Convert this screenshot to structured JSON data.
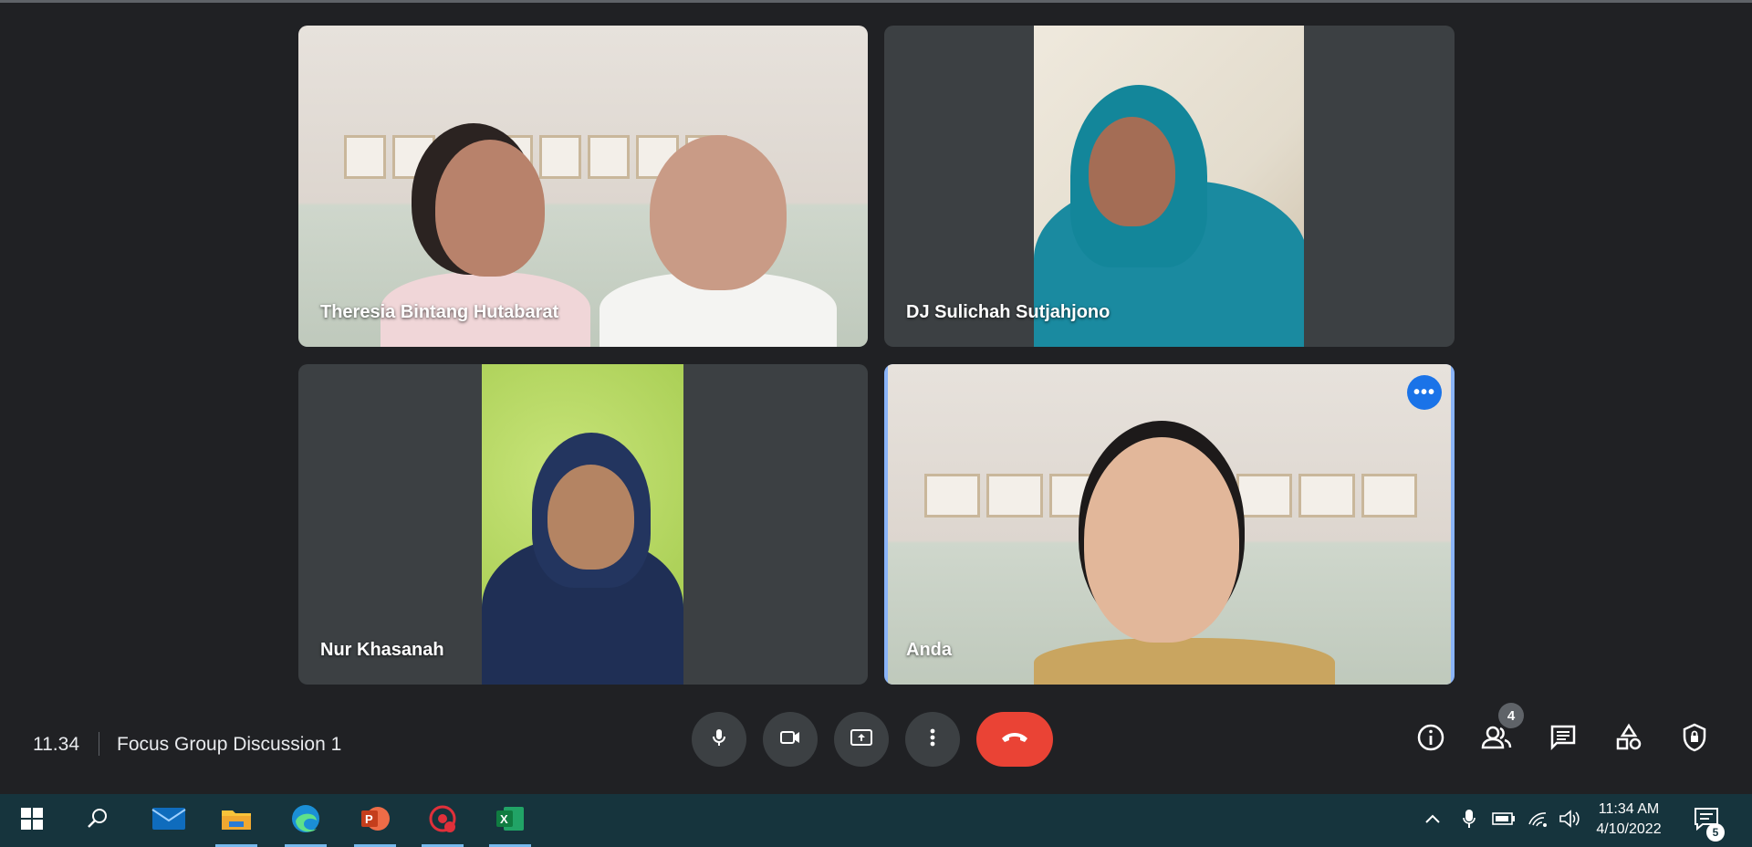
{
  "participants": [
    {
      "name": "Theresia Bintang Hutabarat"
    },
    {
      "name": "DJ Sulichah Sutjahjono"
    },
    {
      "name": "Nur Khasanah"
    },
    {
      "name": "Anda",
      "selected": true,
      "menu_glyph": "•••"
    }
  ],
  "meeting": {
    "time": "11.34",
    "title": "Focus Group Discussion 1",
    "participant_count": "4"
  },
  "controls": {
    "icons": [
      "microphone-icon",
      "camera-icon",
      "present-screen-icon",
      "more-options-icon",
      "hang-up-icon"
    ],
    "right_icons": [
      "info-icon",
      "people-icon",
      "chat-icon",
      "activities-icon",
      "host-controls-icon"
    ]
  },
  "taskbar": {
    "icons": [
      "windows-start-icon",
      "search-icon",
      "mail-icon",
      "file-explorer-icon",
      "edge-icon",
      "powerpoint-icon",
      "screen-recorder-icon",
      "excel-icon"
    ],
    "tray_icons": [
      "chevron-up-icon",
      "microphone-icon",
      "battery-icon",
      "wifi-icon",
      "volume-icon"
    ],
    "clock_time": "11:34 AM",
    "clock_date": "4/10/2022",
    "notification_count": "5"
  },
  "colors": {
    "background": "#202124",
    "tile": "#3c4043",
    "hangup": "#ea4335",
    "selected_outline": "#8ab4f8",
    "taskbar": "#16343d"
  }
}
